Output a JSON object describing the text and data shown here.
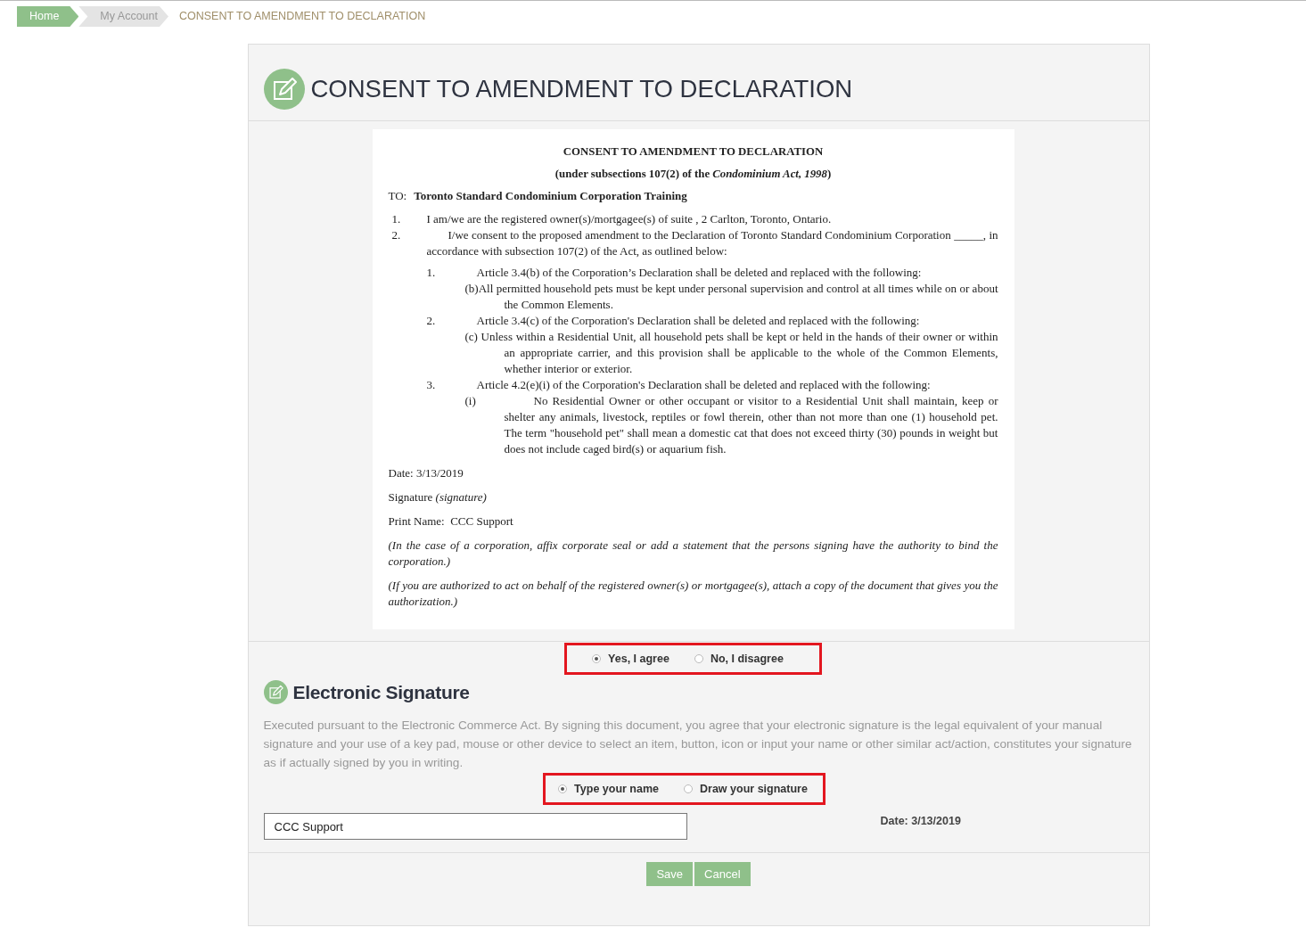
{
  "breadcrumb": [
    {
      "label": "Home"
    },
    {
      "label": "My Account"
    },
    {
      "label": "CONSENT TO AMENDMENT TO DECLARATION"
    }
  ],
  "page_title": "CONSENT TO AMENDMENT TO DECLARATION",
  "document": {
    "title": "CONSENT TO AMENDMENT TO DECLARATION",
    "subtitle": "(under subsections 107(2) of the *Condominium Act, 1998*)",
    "to_label": "TO:",
    "to_name": "Toronto Standard Condominium Corporation Training",
    "items": [
      {
        "number": "1.",
        "text": "I am/we are the registered owner(s)/mortgagee(s) of suite , 2 Carlton, Toronto, Ontario."
      },
      {
        "number": "2.",
        "text": "I/we consent to the proposed amendment to the Declaration of Toronto Standard Condominium Corporation _____, in accordance with subsection 107(2) of the Act, as outlined below:",
        "articles": [
          {
            "number": "1.",
            "text": "Article 3.4(b) of the Corporation’s Declaration shall be deleted and replaced with the following:",
            "clause": {
              "kind": "inline",
              "text": "(b)All permitted household pets must be kept under personal supervision and control at all times while on or about the Common Elements."
            }
          },
          {
            "number": "2.",
            "text": "Article 3.4(c) of the Corporation's Declaration shall be deleted and replaced with the following:",
            "clause": {
              "kind": "inline",
              "text": "(c) Unless within a Residential Unit, all household pets shall be kept or held in the hands of their owner or within an appropriate carrier, and this provision shall be applicable to the whole of the Common Elements, whether interior or exterior."
            }
          },
          {
            "number": "3.",
            "text": "Article 4.2(e)(i) of the Corporation's Declaration shall be deleted and replaced with the following:",
            "clause": {
              "kind": "tabbed",
              "label": "(i)",
              "text": "No Residential Owner or other occupant or visitor to a Residential Unit shall maintain, keep or shelter any animals, livestock, reptiles or fowl therein, other than not more than one (1) household pet. The term \"household pet\" shall mean a domestic cat that does not exceed thirty (30) pounds in weight but does not include caged bird(s) or aquarium fish."
            }
          }
        ]
      }
    ],
    "date": "Date: 3/13/2019",
    "signature": "Signature *(signature)*",
    "print_name": "Print Name:  CCC Support",
    "notes": [
      "(In the case of a corporation, affix corporate seal or add a statement that the persons signing have the authority to bind the corporation.)",
      "(If you are authorized to act on behalf of the registered owner(s) or mortgagee(s), attach a copy of the document that gives you the authorization.)"
    ]
  },
  "consent_options": [
    {
      "label": "Yes, I agree",
      "selected": true
    },
    {
      "label": "No, I disagree",
      "selected": false
    }
  ],
  "esign": {
    "title": "Electronic Signature",
    "description": "Executed pursuant to the Electronic Commerce Act. By signing this document, you agree that your electronic signature is the legal equivalent of your manual signature and your use of a key pad, mouse or other device to select an item, button, icon or input your name or other similar act/action, constitutes your signature as if actually signed by you in writing.",
    "method_options": [
      {
        "label": "Type your name",
        "selected": true
      },
      {
        "label": "Draw your signature",
        "selected": false
      }
    ],
    "name_value": "CCC Support",
    "date": "Date: 3/13/2019"
  },
  "buttons": [
    "Save",
    "Cancel"
  ]
}
